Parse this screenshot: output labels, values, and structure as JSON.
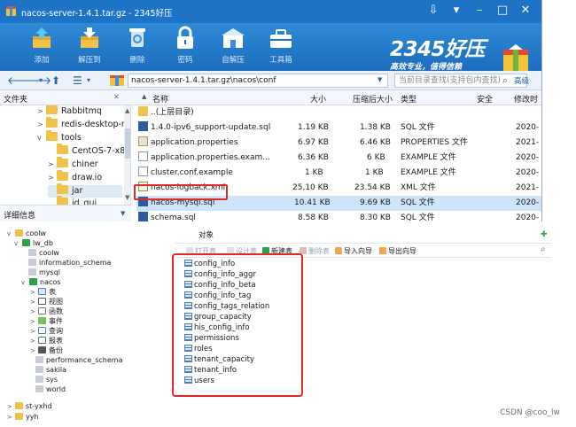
{
  "window": {
    "title": "nacos-server-1.4.1.tar.gz - 2345好压",
    "controls": [
      "⇩",
      "▾",
      "–",
      "□",
      "✕"
    ]
  },
  "toolbar": {
    "buttons": [
      "添加",
      "解压到",
      "删除",
      "密码",
      "自解压",
      "工具箱"
    ],
    "brand_big": "2345好压",
    "brand_small": "高效专业，值得信赖"
  },
  "address": {
    "path": "nacos-server-1.4.1.tar.gz\\nacos\\conf",
    "search_placeholder": "当前目录查找(支持包内查找)",
    "search_link": "高级"
  },
  "header": {
    "folders": "文件夹",
    "name": "名称",
    "size": "大小",
    "packed": "压缩后大小",
    "type": "类型",
    "security": "安全",
    "modified": "修改时"
  },
  "folder_tree": [
    {
      "label": "Rabbitmq",
      "arrow": ">"
    },
    {
      "label": "redis-desktop-n",
      "arrow": ">"
    },
    {
      "label": "tools",
      "arrow": "v"
    },
    {
      "label": "CentOS-7-x86_",
      "arrow": ""
    },
    {
      "label": "chiner",
      "arrow": ">"
    },
    {
      "label": "draw.io",
      "arrow": ">"
    },
    {
      "label": "jar",
      "arrow": ""
    },
    {
      "label": "jd_gui",
      "arrow": ""
    }
  ],
  "details_label": "详细信息",
  "files": [
    {
      "name": "..(上层目录)",
      "size": "",
      "packed": "",
      "type": "",
      "date": "",
      "icon": "folder"
    },
    {
      "name": "1.4.0-ipv6_support-update.sql",
      "size": "1.19 KB",
      "packed": "1.38 KB",
      "type": "SQL 文件",
      "date": "2020-",
      "icon": "sql"
    },
    {
      "name": "application.properties",
      "size": "6.97 KB",
      "packed": "6.46 KB",
      "type": "PROPERTIES 文件",
      "date": "2021-",
      "icon": "prop"
    },
    {
      "name": "application.properties.exam...",
      "size": "6.36 KB",
      "packed": "6 KB",
      "type": "EXAMPLE 文件",
      "date": "2020-",
      "icon": "doc"
    },
    {
      "name": "cluster.conf.example",
      "size": "1 KB",
      "packed": "1 KB",
      "type": "EXAMPLE 文件",
      "date": "2020-",
      "icon": "doc"
    },
    {
      "name": "nacos-logback.xml",
      "size": "25.10 KB",
      "packed": "23.54 KB",
      "type": "XML 文件",
      "date": "2021-",
      "icon": "xml"
    },
    {
      "name": "nacos-mysql.sql",
      "size": "10.41 KB",
      "packed": "9.69 KB",
      "type": "SQL 文件",
      "date": "2020-",
      "icon": "sql"
    },
    {
      "name": "schema.sql",
      "size": "8.58 KB",
      "packed": "8.30 KB",
      "type": "SQL 文件",
      "date": "2020-",
      "icon": "sql"
    }
  ],
  "db_tree": [
    {
      "label": "coolw",
      "arrow": "v",
      "icon": "conn"
    },
    {
      "label": "lw_db",
      "arrow": "v",
      "icon": "conn2"
    },
    {
      "label": "coolw",
      "arrow": "",
      "icon": "db"
    },
    {
      "label": "information_schema",
      "arrow": "",
      "icon": "db"
    },
    {
      "label": "mysql",
      "arrow": "",
      "icon": "db"
    },
    {
      "label": "nacos",
      "arrow": "v",
      "icon": "dbon"
    },
    {
      "label": "表",
      "arrow": ">",
      "icon": "table"
    },
    {
      "label": "视图",
      "arrow": ">",
      "icon": "view"
    },
    {
      "label": "函数",
      "arrow": ">",
      "icon": "func"
    },
    {
      "label": "事件",
      "arrow": ">",
      "icon": "event"
    },
    {
      "label": "查询",
      "arrow": ">",
      "icon": "query"
    },
    {
      "label": "报表",
      "arrow": ">",
      "icon": "report"
    },
    {
      "label": "备份",
      "arrow": ">",
      "icon": "backup"
    },
    {
      "label": "performance_schema",
      "arrow": "",
      "icon": "db"
    },
    {
      "label": "sakila",
      "arrow": "",
      "icon": "db"
    },
    {
      "label": "sys",
      "arrow": "",
      "icon": "db"
    },
    {
      "label": "world",
      "arrow": "",
      "icon": "db"
    },
    {
      "label": "st-yxhd",
      "arrow": ">",
      "icon": "conn"
    },
    {
      "label": "yyh",
      "arrow": ">",
      "icon": "conn"
    }
  ],
  "objects": {
    "tab": "对象",
    "toolbar": [
      "打开表",
      "设计表",
      "新建表",
      "删除表",
      "导入向导",
      "导出向导"
    ],
    "tables": [
      "config_info",
      "config_info_aggr",
      "config_info_beta",
      "config_info_tag",
      "config_tags_relation",
      "group_capacity",
      "his_config_info",
      "permissions",
      "roles",
      "tenant_capacity",
      "tenant_info",
      "users"
    ]
  },
  "watermark": "CSDN @coo_lw",
  "colors": {
    "title_blue": "#1d74c6",
    "toolbar_blue": "#2f8ad8",
    "highlight_red": "#e0282a",
    "selection": "#cde4fb"
  }
}
